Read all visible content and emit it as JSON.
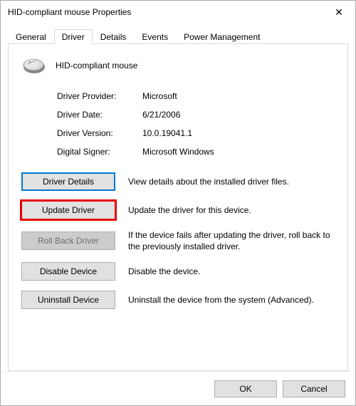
{
  "window": {
    "title": "HID-compliant mouse Properties"
  },
  "tabs": {
    "items": [
      {
        "label": "General"
      },
      {
        "label": "Driver"
      },
      {
        "label": "Details"
      },
      {
        "label": "Events"
      },
      {
        "label": "Power Management"
      }
    ],
    "active_index": 1
  },
  "device": {
    "name": "HID-compliant mouse"
  },
  "info": {
    "provider_label": "Driver Provider:",
    "provider_value": "Microsoft",
    "date_label": "Driver Date:",
    "date_value": "6/21/2006",
    "version_label": "Driver Version:",
    "version_value": "10.0.19041.1",
    "signer_label": "Digital Signer:",
    "signer_value": "Microsoft Windows"
  },
  "actions": {
    "driver_details": {
      "label": "Driver Details",
      "desc": "View details about the installed driver files."
    },
    "update_driver": {
      "label": "Update Driver",
      "desc": "Update the driver for this device."
    },
    "roll_back": {
      "label": "Roll Back Driver",
      "desc": "If the device fails after updating the driver, roll back to the previously installed driver."
    },
    "disable": {
      "label": "Disable Device",
      "desc": "Disable the device."
    },
    "uninstall": {
      "label": "Uninstall Device",
      "desc": "Uninstall the device from the system (Advanced)."
    }
  },
  "footer": {
    "ok": "OK",
    "cancel": "Cancel"
  }
}
